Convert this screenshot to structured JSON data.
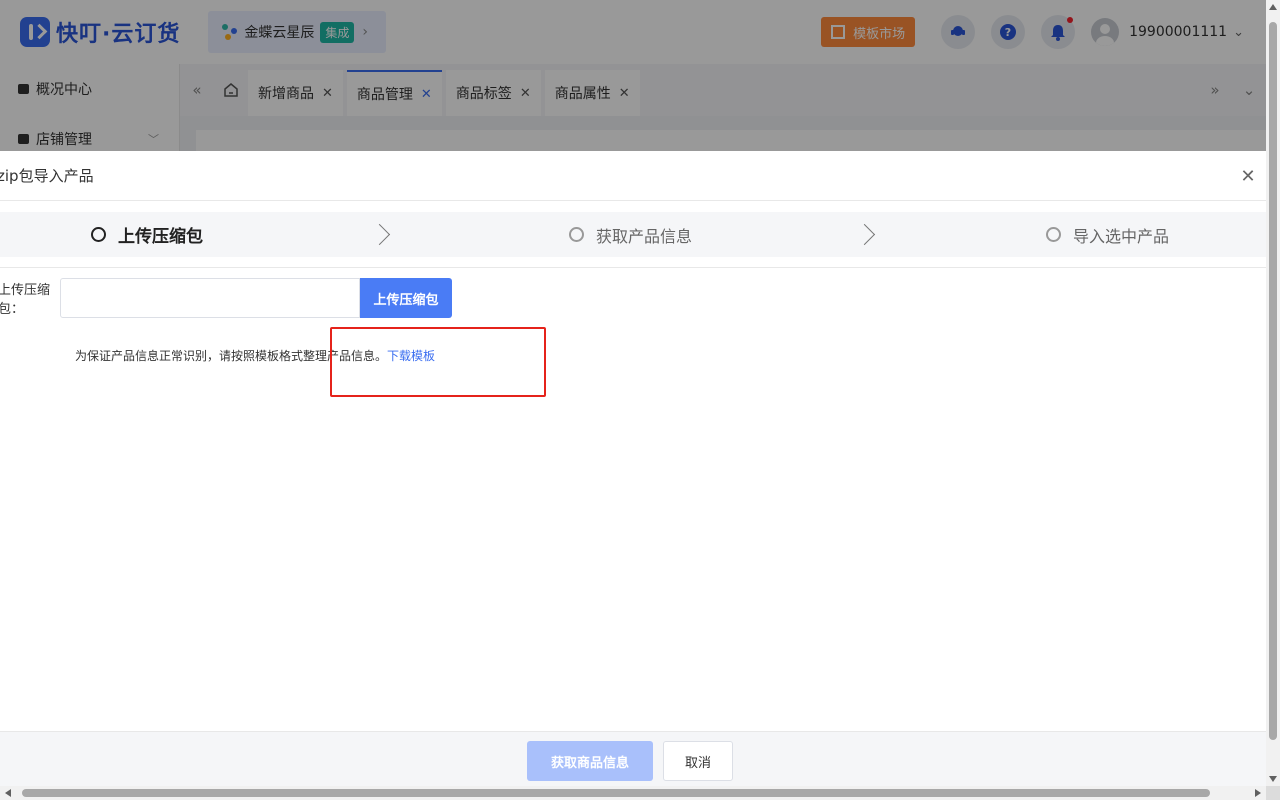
{
  "header": {
    "brand": "快叮·云订货",
    "org_name": "金蝶云星辰",
    "org_badge": "集成",
    "template_market": "模板市场",
    "user_phone": "19900001111"
  },
  "sidebar": {
    "items": [
      {
        "label": "概况中心"
      },
      {
        "label": "店铺管理"
      }
    ]
  },
  "tabs": [
    {
      "label": "新增商品",
      "active": false
    },
    {
      "label": "商品管理",
      "active": true
    },
    {
      "label": "商品标签",
      "active": false
    },
    {
      "label": "商品属性",
      "active": false
    }
  ],
  "modal": {
    "title": "zip包导入产品",
    "steps": [
      {
        "label": "上传压缩包",
        "active": true
      },
      {
        "label": "获取产品信息",
        "active": false
      },
      {
        "label": "导入选中产品",
        "active": false
      }
    ],
    "upload_label": "上传压缩包：",
    "upload_value": "",
    "upload_button": "上传压缩包",
    "hint_text": "为保证产品信息正常识别，请按照模板格式整理产品信息。",
    "download_link": "下载模板",
    "footer_primary": "获取商品信息",
    "footer_cancel": "取消"
  },
  "icons": {
    "close": "close-icon",
    "home": "home-icon",
    "bell": "bell-icon",
    "help": "help-icon",
    "support": "support-icon"
  },
  "colors": {
    "primary": "#4a7cf5",
    "primary_disabled": "#a9c0fb",
    "accent_orange": "#ff8b3d",
    "highlight_red": "#e5231b",
    "badge_teal": "#1fb7a6"
  }
}
